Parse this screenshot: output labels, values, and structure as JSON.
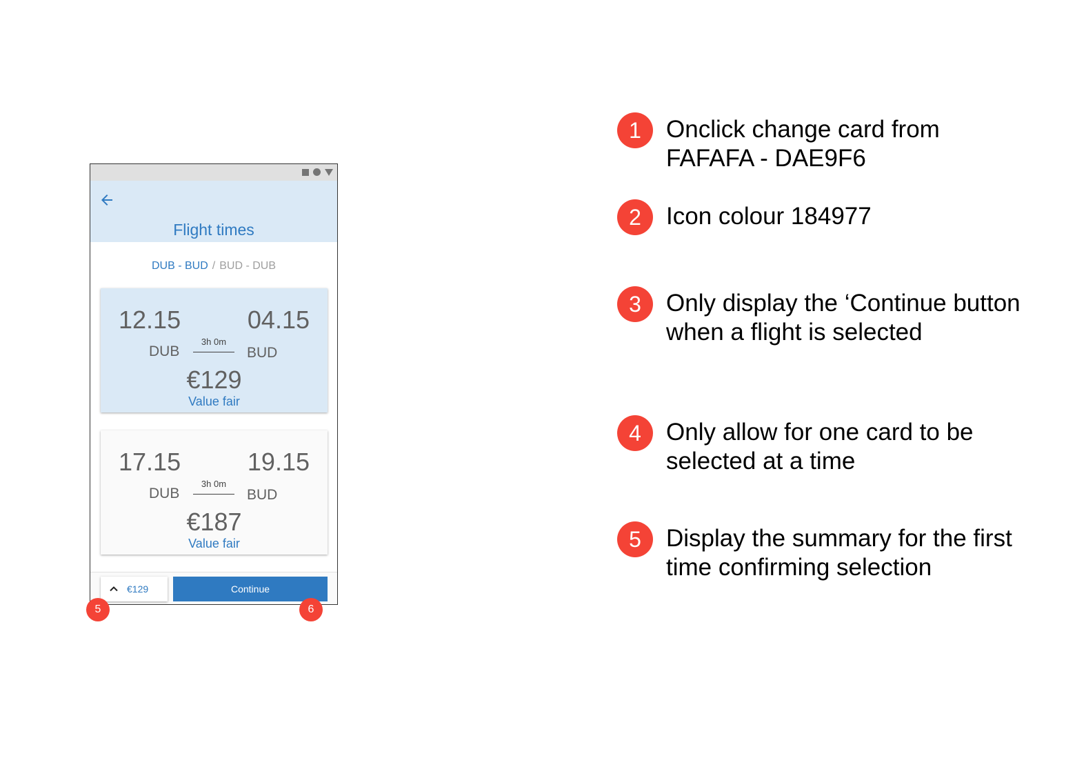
{
  "app": {
    "title": "Flight times",
    "segments": {
      "active": "DUB - BUD",
      "separator": "/",
      "inactive": "BUD - DUB"
    },
    "cards": [
      {
        "depart_time": "12.15",
        "arrive_time": "04.15",
        "depart_code": "DUB",
        "arrive_code": "BUD",
        "duration": "3h 0m",
        "price": "€129",
        "fare": "Value fair",
        "selected": true
      },
      {
        "depart_time": "17.15",
        "arrive_time": "19.15",
        "depart_code": "DUB",
        "arrive_code": "BUD",
        "duration": "3h 0m",
        "price": "€187",
        "fare": "Value fair",
        "selected": false
      }
    ],
    "bottom_bar": {
      "summary_price": "€129",
      "continue_label": "Continue"
    },
    "markers": [
      "5",
      "6"
    ]
  },
  "notes": [
    {
      "number": "1",
      "text": "Onclick change card from FAFAFA - DAE9F6"
    },
    {
      "number": "2",
      "text": "Icon colour 184977"
    },
    {
      "number": "3",
      "text": "Only display the ‘Continue button when a flight is selected"
    },
    {
      "number": "4",
      "text": "Only allow for one card to be selected at a time"
    },
    {
      "number": "5",
      "text": "Display the summary for the first time confirming selection"
    }
  ],
  "colors": {
    "accent": "#2f7ac1",
    "selected_card": "#dae9f6",
    "unselected_card": "#fafafa",
    "marker": "#f44336"
  },
  "icons": {
    "back": "arrow-back-icon",
    "summary_toggle": "chevron-up-icon",
    "status": [
      "square-icon",
      "circle-icon",
      "triangle-icon"
    ]
  }
}
